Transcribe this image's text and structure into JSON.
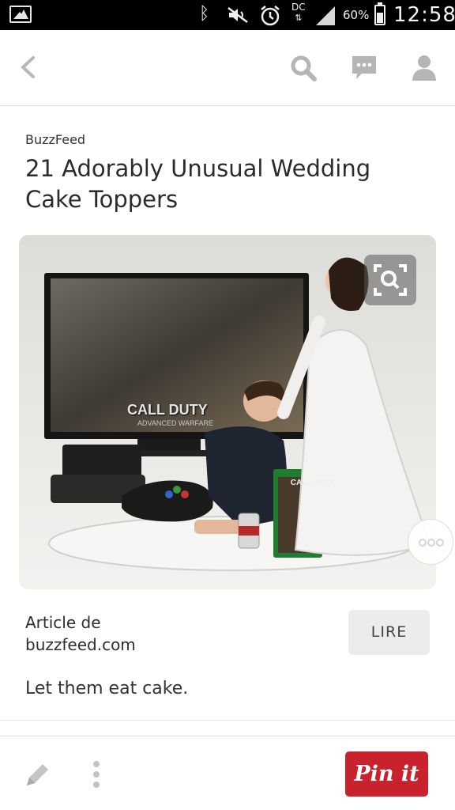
{
  "status_bar": {
    "notification_icon": "gallery-icon",
    "icons": [
      "bluetooth-icon",
      "mute-icon",
      "alarm-icon",
      "data-icon",
      "signal-icon"
    ],
    "data_label": "DC",
    "data_arrows": "⇅",
    "battery_percent": "60%",
    "battery_level": 0.6,
    "time": "12:58"
  },
  "app_bar": {
    "icons": [
      "back-icon",
      "search-icon",
      "messages-icon",
      "profile-icon"
    ]
  },
  "pin": {
    "source": "BuzzFeed",
    "title": "21 Adorably Unusual Wedding Cake Toppers",
    "image": {
      "zoom_icon": "zoom-search-icon",
      "more_icon": "more-options-icon",
      "caption_text_on_screen": "CALL DUTY",
      "caption_subtext": "ADVANCED WARFARE",
      "box_text": "CALL DUTY"
    },
    "article_label": "Article de",
    "article_domain": "buzzfeed.com",
    "read_button": "LIRE",
    "description": "Let them eat cake."
  },
  "bottom_bar": {
    "edit_icon": "pencil-icon",
    "menu_icon": "vertical-dots-icon",
    "pin_button": "Pin it",
    "accent_color": "#c8232c"
  }
}
